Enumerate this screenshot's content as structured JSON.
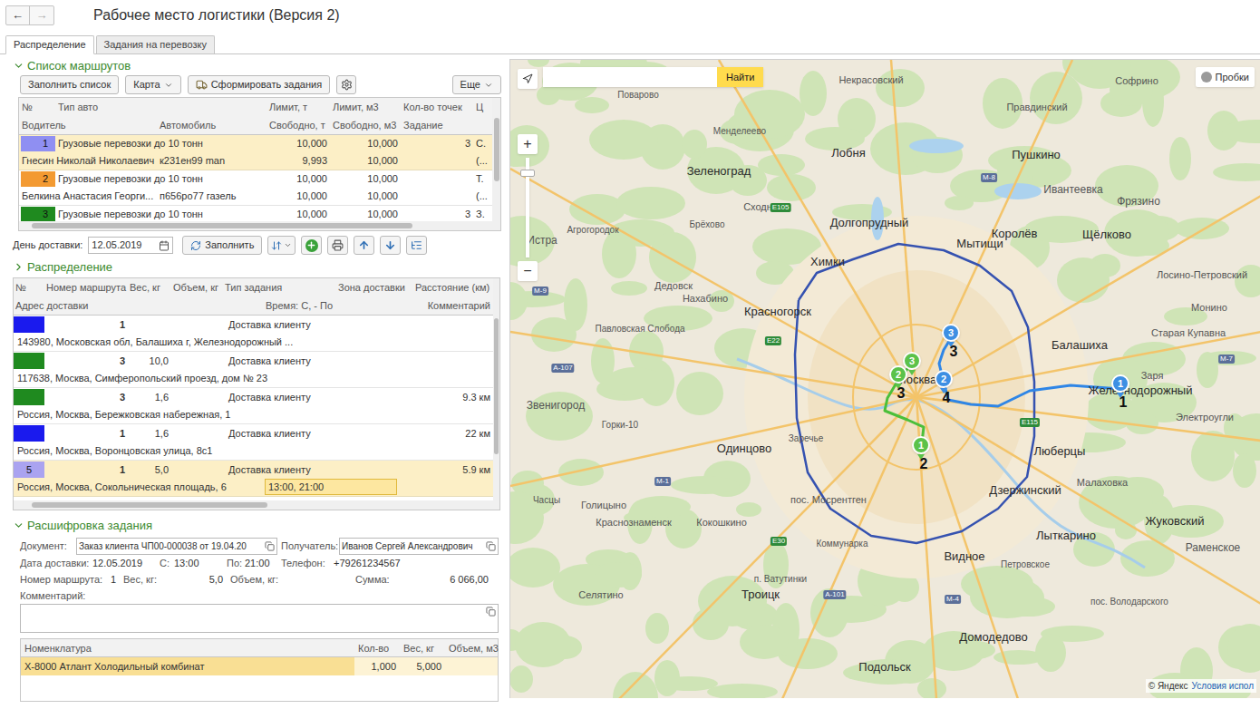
{
  "window": {
    "title": "Рабочее место логистики (Версия 2)",
    "back": "←",
    "forward": "→",
    "forward_disabled": true
  },
  "tabs": [
    {
      "label": "Распределение",
      "selected": true
    },
    {
      "label": "Задания на перевозку",
      "selected": false
    }
  ],
  "routes": {
    "title": "Список маршрутов",
    "expanded": true,
    "toolbar": [
      {
        "label": "Заполнить список",
        "kind": "button"
      },
      {
        "label": "Карта",
        "kind": "dropdown"
      },
      {
        "label": "Сформировать задания",
        "kind": "icon-button"
      }
    ],
    "more": "Еще",
    "columns_top": [
      "№",
      "Тип авто",
      "Лимит, т",
      "Лимит, м3",
      "Кол-во точек",
      "Ц"
    ],
    "columns_bottom": [
      "Водитель",
      "Автомобиль",
      "Свободно, т",
      "Свободно, м3",
      "Задание",
      ""
    ],
    "rows": [
      {
        "number": "1",
        "color": "#8f8ff2",
        "type": "Грузовые перевозки до 10 тонн",
        "limit_t": "10,000",
        "limit_m3": "10,000",
        "points": "3",
        "c": "С.",
        "driver": "Гнесин Николай Николаевич",
        "vehicle": "к231ен99 man",
        "free_t": "9,993",
        "free_m3": "10,000",
        "task": "",
        "c2": "(...",
        "selected": true
      },
      {
        "number": "2",
        "color": "#f39a32",
        "type": "Грузовые перевозки до 10 тонн",
        "limit_t": "10,000",
        "limit_m3": "10,000",
        "points": "",
        "c": "Т.",
        "driver": "Белкина Анастасия Георги...",
        "vehicle": "п656ро77 газель",
        "free_t": "10,000",
        "free_m3": "10,000",
        "task": "",
        "c2": "(...",
        "selected": false
      },
      {
        "number": "3",
        "color": "#1f8a1f",
        "type": "Грузовые перевозки до 10 тонн",
        "limit_t": "10,000",
        "limit_m3": "10,000",
        "points": "3",
        "c": "З.",
        "driver": "",
        "vehicle": "",
        "free_t": "",
        "free_m3": "",
        "task": "",
        "c2": "",
        "selected": false
      }
    ]
  },
  "date_row": {
    "label": "День доставки:",
    "value": "12.05.2019",
    "fill_button": "Заполнить"
  },
  "distribution": {
    "title": "Распределение",
    "expanded": false,
    "columns_top": [
      "№",
      "Номер маршрута",
      "Вес, кг",
      "Объем, кг",
      "Тип задания",
      "Зона доставки",
      "Расстояние (км)"
    ],
    "columns_bottom": [
      "Адрес доставки",
      "Время: С, - По",
      "Комментарий"
    ],
    "rows": [
      {
        "number": "",
        "color": "#1a1aee",
        "route": "1",
        "weight": "",
        "volume": "",
        "type": "Доставка клиенту",
        "zone": "",
        "distance": "",
        "address": "143980, Московская обл, Балашиха г, Железнодорожный ...",
        "time": "",
        "comment": "",
        "selected": false
      },
      {
        "number": "",
        "color": "#1f8a1f",
        "route": "3",
        "weight": "10,0",
        "volume": "",
        "type": "Доставка клиенту",
        "zone": "",
        "distance": "",
        "address": "117638, Москва, Симферопольский проезд, дом № 23",
        "time": "",
        "comment": "",
        "selected": false
      },
      {
        "number": "",
        "color": "#1f8a1f",
        "route": "3",
        "weight": "1,6",
        "volume": "",
        "type": "Доставка клиенту",
        "zone": "",
        "distance": "9.3 км",
        "address": "Россия, Москва, Бережковская набережная, 1",
        "time": "",
        "comment": "",
        "selected": false
      },
      {
        "number": "",
        "color": "#1a1aee",
        "route": "1",
        "weight": "1,6",
        "volume": "",
        "type": "Доставка клиенту",
        "zone": "",
        "distance": "22 км",
        "address": "Россия, Москва, Воронцовская улица, 8с1",
        "time": "",
        "comment": "",
        "selected": false
      },
      {
        "number": "5",
        "color": "#aaa3f0",
        "route": "1",
        "weight": "5,0",
        "volume": "",
        "type": "Доставка клиенту",
        "zone": "",
        "distance": "5.9 км",
        "address": "Россия, Москва, Сокольническая площадь, 6",
        "time": "13:00, 21:00",
        "comment": "",
        "selected": true
      }
    ]
  },
  "details": {
    "title": "Расшифровка задания",
    "expanded": true,
    "document": {
      "label": "Документ:",
      "value": "Заказ клиента ЧП00-000038 от 19.04.20"
    },
    "recipient": {
      "label": "Получатель:",
      "value": "Иванов Сергей Александрович"
    },
    "date": {
      "label": "Дата доставки:",
      "value": "12.05.2019"
    },
    "from": {
      "label": "С:",
      "value": "13:00"
    },
    "to": {
      "label": "По:",
      "value": "21:00"
    },
    "phone": {
      "label": "Телефон:",
      "value": "+79261234567"
    },
    "route": {
      "label": "Номер маршрута:",
      "value": "1"
    },
    "weight": {
      "label": "Вес, кг:",
      "value": "5,0"
    },
    "volume": {
      "label": "Объем, кг:",
      "value": ""
    },
    "sum": {
      "label": "Сумма:",
      "value": "6 066,00"
    },
    "comment": {
      "label": "Комментарий:",
      "value": ""
    }
  },
  "goods": {
    "columns": [
      "Номенклатура",
      "Кол-во",
      "Вес, кг",
      "Объем, м3"
    ],
    "rows": [
      {
        "name": "Х-8000 Атлант Холодильный комбинат",
        "qty": "1,000",
        "weight": "5,000",
        "volume": "",
        "selected": true
      }
    ]
  },
  "map": {
    "search": {
      "value": "",
      "button": "Найти"
    },
    "traffic": {
      "label": "Пробки",
      "on": false
    },
    "zoom_in": "+",
    "zoom_out": "−",
    "zoom_level": 0.88,
    "places": [
      "Поварово",
      "Некрасовский",
      "Правдинский",
      "Софрино",
      "Менделеево",
      "Лобня",
      "Пушкино",
      "Зеленоград",
      "Ивантеевка",
      "Фрязино",
      "Сходня",
      "Долгопрудный",
      "Брёхово",
      "Агрогородок",
      "Королёв",
      "Щёлково",
      "Истра",
      "Мытищи",
      "Химки",
      "Лосино-Петровский",
      "Дедовск",
      "Нахабино",
      "Монино",
      "Красногорск",
      "Павловская Слобода",
      "Старая Купавна",
      "Балашиха",
      "Заря",
      "Москва",
      "Железнодорожный",
      "Звенигород",
      "Электроугли",
      "Горки-10",
      "Заречье",
      "Одинцово",
      "Люберцы",
      "Малаховка",
      "Дзержинский",
      "пос. Мосрентген",
      "Часцы",
      "Голицыно",
      "Краснознаменск",
      "Кокошкино",
      "Жуковский",
      "Лыткарино",
      "Коммунарка",
      "Раменское",
      "Видное",
      "Петровское",
      "п. Ватутинки",
      "Селятино",
      "Троицк",
      "пос. Володарского",
      "Домодедово",
      "Подольск"
    ],
    "road_badges": [
      {
        "label": "М-9",
        "color": "#5b6f99"
      },
      {
        "label": "А-107",
        "color": "#5b6f99"
      },
      {
        "label": "Е22",
        "color": "#2e8b3a"
      },
      {
        "label": "М-1",
        "color": "#5b6f99"
      },
      {
        "label": "Е30",
        "color": "#2e8b3a"
      },
      {
        "label": "А-101",
        "color": "#5b6f99"
      },
      {
        "label": "М-4",
        "color": "#5b6f99"
      },
      {
        "label": "Е115",
        "color": "#2e8b3a"
      },
      {
        "label": "Е105",
        "color": "#2e8b3a"
      },
      {
        "label": "М-8",
        "color": "#5b6f99"
      },
      {
        "label": "М-7",
        "color": "#5b6f99"
      }
    ],
    "lines": [
      {
        "color": "#3552b0"
      },
      {
        "color": "#2f86e6"
      },
      {
        "color": "#4bbf3a"
      }
    ],
    "markers": [
      {
        "label": "1",
        "stop": "1",
        "color": "#3d8fe3"
      },
      {
        "label": "2",
        "stop": "4",
        "color": "#3d8fe3"
      },
      {
        "label": "3",
        "stop": "3",
        "color": "#3d8fe3"
      },
      {
        "label": "1",
        "stop": "2",
        "color": "#5bc24a"
      },
      {
        "label": "2",
        "stop": "3",
        "color": "#5bc24a"
      },
      {
        "label": "3",
        "stop": "",
        "color": "#5bc24a"
      }
    ],
    "attribution": "© Яндекс",
    "terms": "Условия испол"
  }
}
